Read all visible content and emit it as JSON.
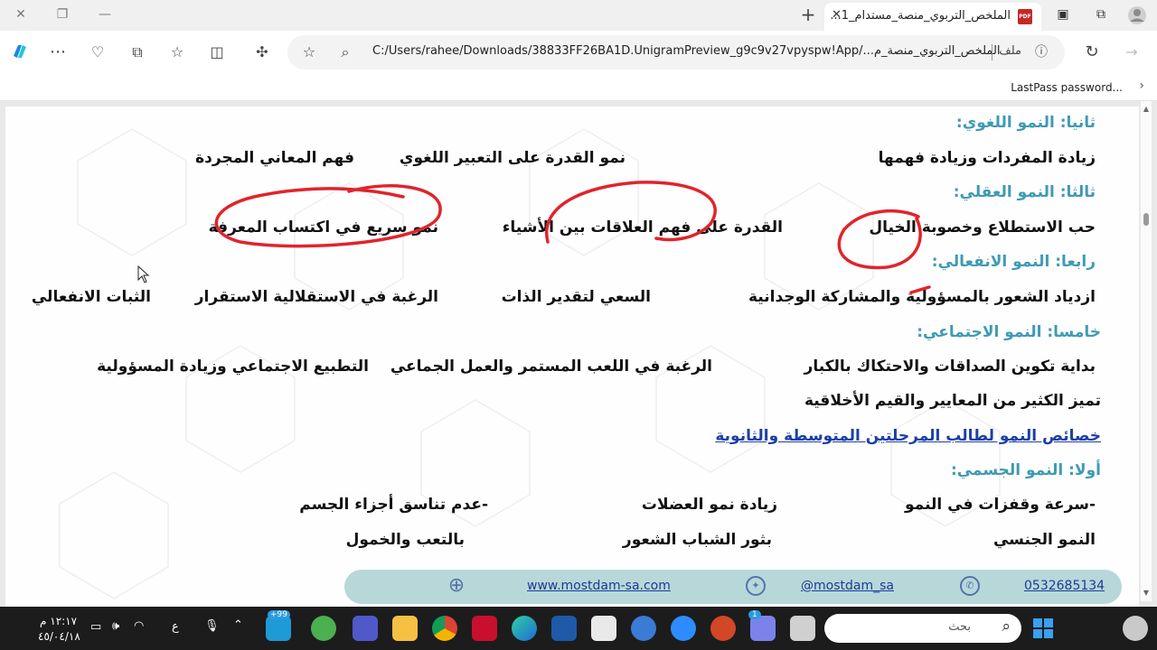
{
  "browser": {
    "tab_title": "الملخص_التربوي_منصة_مستدام_1...",
    "pdf_badge": "PDF",
    "new_tab": "+",
    "close_tab": "✕",
    "url": "C:/Users/rahee/Downloads/38833FF26BA1D.UnigramPreview_g9c9v27vpyspw!App/...الملخص_التربوي_منصة_م",
    "file_label": "ملف",
    "bookmark": "LastPass password..."
  },
  "document": {
    "lines": [
      {
        "id": "h2",
        "text": "ثانيا: النمو اللغوي:",
        "type": "heading"
      },
      {
        "id": "l1a",
        "text": "زيادة المفردات وزيادة فهمها"
      },
      {
        "id": "l1b",
        "text": "نمو القدرة على التعبير اللغوي"
      },
      {
        "id": "l1c",
        "text": "فهم المعاني المجردة"
      },
      {
        "id": "h3",
        "text": "ثالثا: النمو العقلي:",
        "type": "heading"
      },
      {
        "id": "l2a",
        "text": "حب الاستطلاع وخصوبة الخيال"
      },
      {
        "id": "l2b",
        "text": "القدرة على فهم العلاقات بين الأشياء"
      },
      {
        "id": "l2c",
        "text": "نمو سريع في اكتساب المعرفة"
      },
      {
        "id": "h4",
        "text": "رابعا: النمو الانفعالي:",
        "type": "heading"
      },
      {
        "id": "l3a",
        "text": "ازدياد الشعور بالمسؤولية والمشاركة الوجدانية"
      },
      {
        "id": "l3b",
        "text": "السعي لتقدير الذات"
      },
      {
        "id": "l3c",
        "text": "الرغبة في الاستقلالية الاستقرار"
      },
      {
        "id": "l3d",
        "text": "الثبات الانفعالي"
      },
      {
        "id": "h5",
        "text": "خامسا: النمو الاجتماعي:",
        "type": "heading"
      },
      {
        "id": "l4a",
        "text": "بداية تكوين الصداقات والاحتكاك بالكبار"
      },
      {
        "id": "l4b",
        "text": "الرغبة في اللعب المستمر والعمل الجماعي"
      },
      {
        "id": "l4c",
        "text": "التطبيع الاجتماعي وزيادة المسؤولية"
      },
      {
        "id": "l5a",
        "text": "تميز الكثير من المعايير والقيم الأخلاقية"
      },
      {
        "id": "sec",
        "text": "خصائص النمو لطالب المرحلتين المتوسطة والثانوية",
        "type": "link-heading"
      },
      {
        "id": "h1",
        "text": "أولا: النمو الجسمي:",
        "type": "heading"
      },
      {
        "id": "l6a",
        "text": "-سرعة وقفزات في النمو"
      },
      {
        "id": "l6b",
        "text": "زيادة نمو العضلات"
      },
      {
        "id": "l6c",
        "text": "-عدم تناسق أجزاء الجسم"
      },
      {
        "id": "l7a",
        "text": "النمو الجنسي"
      },
      {
        "id": "l7b",
        "text": "بثور الشباب الشعور"
      },
      {
        "id": "l7c",
        "text": "بالتعب والخمول"
      }
    ]
  },
  "banner": {
    "website": "www.mostdam-sa.com",
    "twitter": "@mostdam_sa",
    "phone": "0532685134"
  },
  "taskbar": {
    "time": "١٢:١٧ م",
    "date": "٤٥/٠٤/١٨",
    "lang": "ع",
    "search_placeholder": "بحث",
    "badge_notify": "+99",
    "badge_count": "1"
  },
  "colors": {
    "heading": "#3f9ab4",
    "link_heading": "#1c3fa8",
    "annotation": "#e0242c",
    "banner": "#b8d7d9"
  }
}
